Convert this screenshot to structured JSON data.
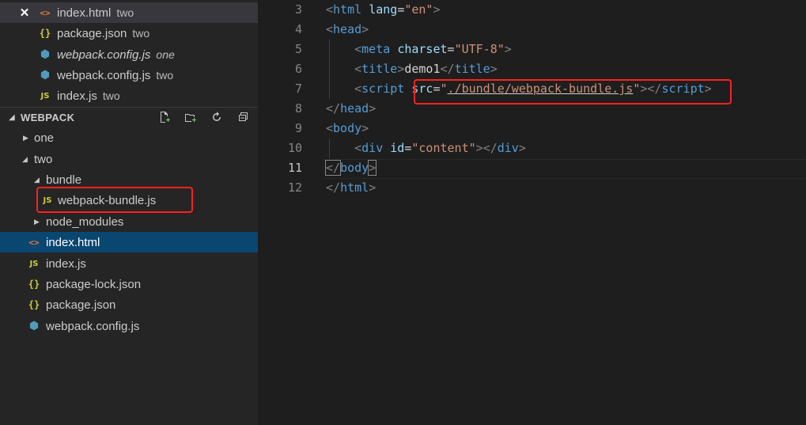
{
  "open_editors": [
    {
      "name": "index.html",
      "desc": "two",
      "icon": "html-icon",
      "glyph": "<>",
      "close": "✕",
      "active": true
    },
    {
      "name": "package.json",
      "desc": "two",
      "icon": "json-icon",
      "glyph": "{}"
    },
    {
      "name": "webpack.config.js",
      "desc": "one",
      "icon": "webpack-icon",
      "glyph": "⬢",
      "italic": true
    },
    {
      "name": "webpack.config.js",
      "desc": "two",
      "icon": "webpack-icon",
      "glyph": "⬢"
    },
    {
      "name": "index.js",
      "desc": "two",
      "icon": "js-icon",
      "glyph": "JS"
    }
  ],
  "explorer": {
    "section_title": "WEBPACK",
    "tools": [
      "new-file-icon",
      "new-folder-icon",
      "refresh-icon",
      "collapse-all-icon"
    ],
    "tree": {
      "one": "one",
      "two": "two",
      "bundle": "bundle",
      "webpack_bundle": "webpack-bundle.js",
      "node_modules": "node_modules",
      "index_html": "index.html",
      "index_js": "index.js",
      "package_lock": "package-lock.json",
      "package_json": "package.json",
      "webpack_config": "webpack.config.js"
    }
  },
  "editor": {
    "line_numbers": [
      "3",
      "4",
      "5",
      "6",
      "7",
      "8",
      "9",
      "10",
      "11",
      "12"
    ],
    "current_line": "11",
    "tokens": {
      "lt": "<",
      "gt": ">",
      "lt_slash": "</",
      "eq": "=",
      "html": "html",
      "head": "head",
      "meta": "meta",
      "title": "title",
      "script": "script",
      "body": "body",
      "div": "div",
      "lang": "lang",
      "charset": "charset",
      "src": "src",
      "id": "id",
      "v_en": "\"en\"",
      "v_utf8": "\"UTF-8\"",
      "v_q": "\"",
      "v_src": "./bundle/webpack-bundle.js",
      "v_content": "\"content\"",
      "demo1": "demo1"
    }
  },
  "colors": {
    "sidebar_bg": "#252526",
    "editor_bg": "#1e1e1e",
    "selection": "#094771",
    "highlight_box": "#ff2020"
  }
}
